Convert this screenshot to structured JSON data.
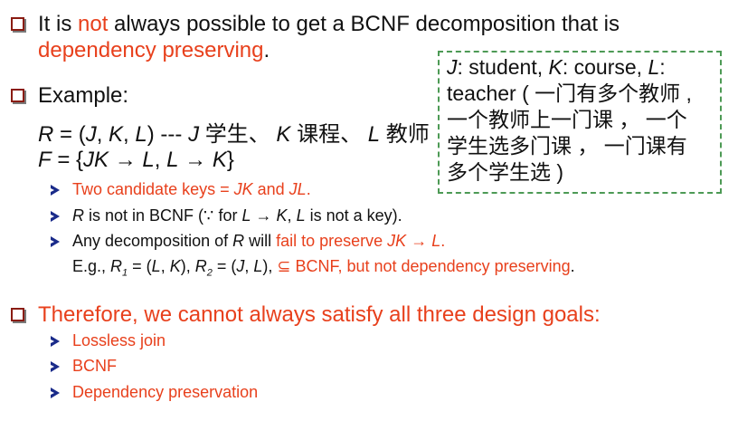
{
  "bullet1": {
    "part1": "It is ",
    "part2_red": "not",
    "part3": " always possible to get a BCNF decomposition that is",
    "line2_red": "dependency preserving",
    "line2_end": "."
  },
  "example": {
    "label": "Example:",
    "r_line": {
      "a": "R",
      "b": " = (",
      "c": "J",
      "d": ", ",
      "e": "K",
      "f": ", ",
      "g": "L",
      "h": ") --- ",
      "i": "J",
      "j": " 学生、 ",
      "k": "K",
      "l": " 课程、 ",
      "m": "L",
      "n": " 教师"
    },
    "f_line": {
      "a": "F",
      "b": " = {",
      "c": "JK",
      "d": " → ",
      "e": "L",
      "f": ", ",
      "g": "L",
      "h": " → ",
      "i": "K",
      "j": "}"
    }
  },
  "sub": {
    "s1": {
      "a": "Two candidate keys = ",
      "b": "JK",
      "c": " and ",
      "d": "JL",
      "e": "."
    },
    "s2": {
      "a": "R",
      "b": " is not in BCNF (∵ for ",
      "c": "L",
      "d": " → ",
      "e": "K",
      "f": ", ",
      "g": "L",
      "h": " is not a key)."
    },
    "s3": {
      "a": "Any decomposition of ",
      "b": "R",
      "c": " will ",
      "d": "fail to preserve",
      "e": "  JK",
      "f": " → ",
      "g": "L",
      "h": "."
    },
    "s4": {
      "a": "E.g., ",
      "b": "R",
      "b_sub": "1",
      "c": " = (",
      "d": "L",
      "e": ", ",
      "f": "K",
      "g": "), ",
      "h": "R",
      "h_sub": "2",
      "i": " = (",
      "j": "J",
      "k": ", ",
      "l": "L",
      "m": "), ",
      "n": "⊆ BCNF, but not dependency preserving",
      "o": "."
    }
  },
  "box": {
    "l1": {
      "a": "J",
      "b": ": student, ",
      "c": "K",
      "d": ": course, ",
      "e": "L",
      "f": ":"
    },
    "l2": "teacher ( 一门有多个教师 ,",
    "l3": "一个教师上一门课 ， 一个",
    "l4": "学生选多门课 ， 一门课有",
    "l5": "多个学生选 )"
  },
  "therefore": {
    "title": "Therefore, we cannot always satisfy all three design goals:",
    "goals": [
      "Lossless join",
      "BCNF",
      "Dependency preservation"
    ]
  },
  "colors": {
    "red": "#e8401c",
    "bullet_box": "#8a1c12",
    "arrow": "#1a2b8a",
    "dash": "#4d9a55"
  }
}
